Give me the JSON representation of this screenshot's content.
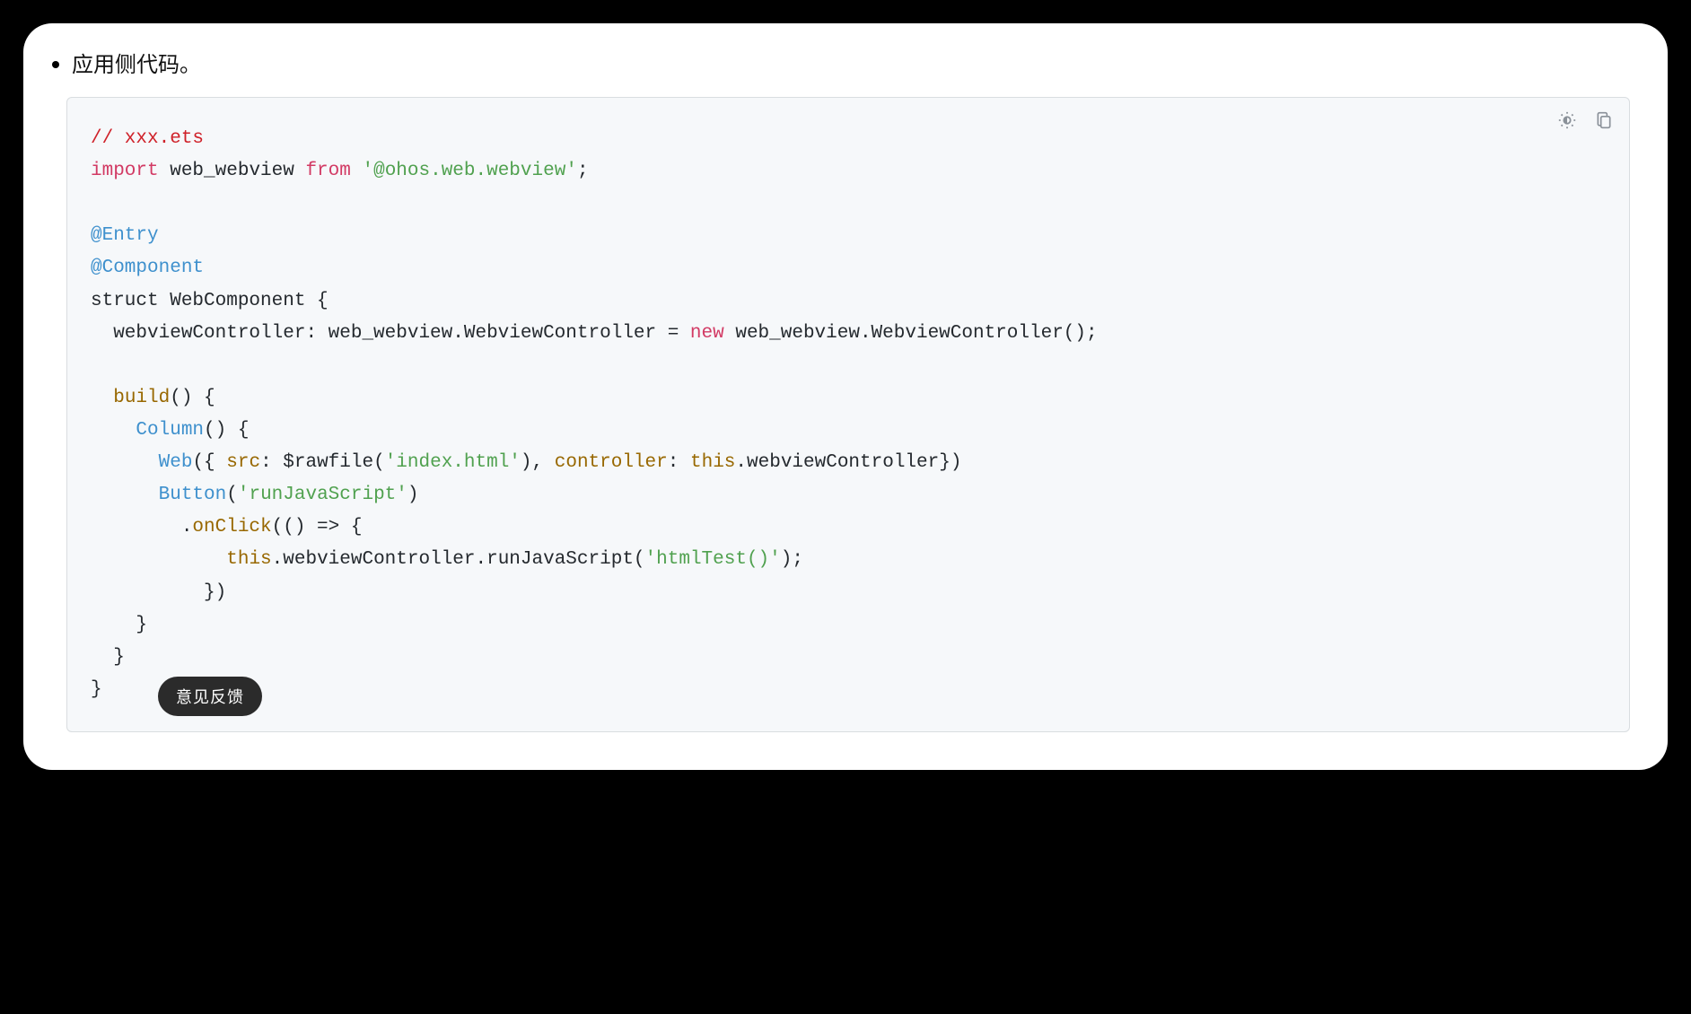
{
  "section": {
    "bullet_text": "应用侧代码。"
  },
  "code": {
    "comment": "// xxx.ets",
    "kw_import": "import",
    "import_name": " web_webview ",
    "kw_from": "from",
    "import_path": "'@ohos.web.webview'",
    "annotation_entry": "@Entry",
    "annotation_component": "@Component",
    "struct_line": "struct WebComponent {",
    "ctrl_decl_a": "  webviewController: web_webview.WebviewController = ",
    "kw_new": "new",
    "ctrl_decl_b": " web_webview.WebviewController();",
    "build_name": "build",
    "build_open": "() {",
    "column_name": "Column",
    "column_open": "() {",
    "web_name": "Web",
    "web_open": "({ ",
    "src_attr": "src",
    "src_colon": ": $rawfile(",
    "src_str": "'index.html'",
    "src_after": "), ",
    "ctrl_attr": "controller",
    "ctrl_colon": ": ",
    "this_kw": "this",
    "ctrl_ref": ".webviewController})",
    "button_name": "Button",
    "button_open": "(",
    "button_str": "'runJavaScript'",
    "button_close": ")",
    "onclick_name": "onClick",
    "onclick_open": "(() => {",
    "runjs_this": "this",
    "runjs_mid": ".webviewController.runJavaScript(",
    "runjs_str": "'htmlTest()'",
    "runjs_end": ");",
    "brace_onclick": "          })",
    "brace_column": "    }",
    "brace_build": "  }",
    "brace_struct": "}"
  },
  "feedback": {
    "label": "意见反馈"
  }
}
